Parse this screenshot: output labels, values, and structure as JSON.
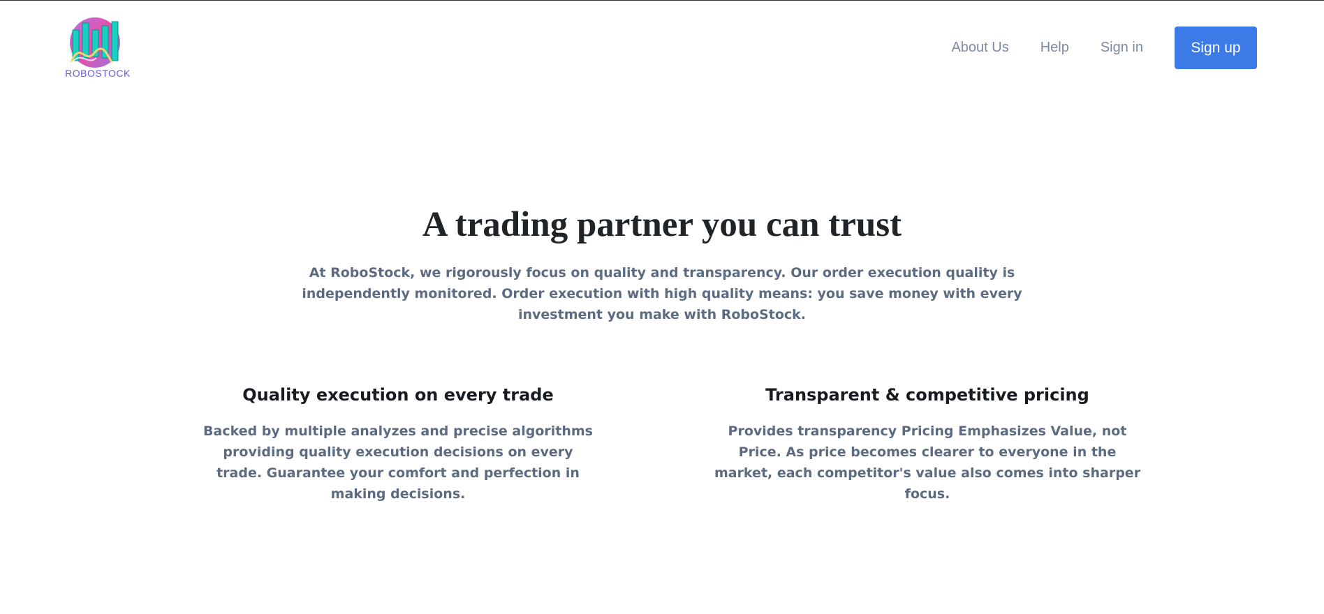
{
  "brand": {
    "name": "ROBOSTOCK",
    "colors": {
      "circle_pink": "#e94ca7",
      "circle_purple": "#8f7ce8",
      "bars": "#19cfc3",
      "wave": "#f5d36b",
      "text": "#6b5bd6"
    }
  },
  "nav": {
    "about": "About Us",
    "help": "Help",
    "signin": "Sign in",
    "signup": "Sign up",
    "signup_color": "#3d7be8"
  },
  "hero": {
    "title": "A trading partner you can trust",
    "description": "At RoboStock, we rigorously focus on quality and transparency. Our order execution quality is independently monitored. Order execution with high quality means: you save money with every investment you make with RoboStock."
  },
  "features": [
    {
      "title": "Quality execution on every trade",
      "description": "Backed by multiple analyzes and precise algorithms providing quality execution decisions on every trade. Guarantee your comfort and perfection in making decisions."
    },
    {
      "title": "Transparent & competitive pricing",
      "description": "Provides transparency Pricing Emphasizes Value, not Price. As price becomes clearer to everyone in the market, each competitor's value also comes into sharper focus."
    }
  ]
}
